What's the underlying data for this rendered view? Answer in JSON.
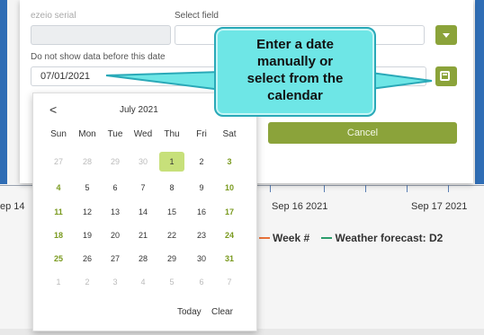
{
  "dialog": {
    "serial_label": "ezeio serial",
    "select_field_label": "Select field",
    "date_filter_label": "Do not show data before this date",
    "date_value": "07/01/2021",
    "cancel_label": "Cancel"
  },
  "calendar": {
    "month_title": "July 2021",
    "prev_glyph": "<",
    "weekdays": [
      "Sun",
      "Mon",
      "Tue",
      "Wed",
      "Thu",
      "Fri",
      "Sat"
    ],
    "weeks": [
      [
        "27",
        "28",
        "29",
        "30",
        "1",
        "2",
        "3"
      ],
      [
        "4",
        "5",
        "6",
        "7",
        "8",
        "9",
        "10"
      ],
      [
        "11",
        "12",
        "13",
        "14",
        "15",
        "16",
        "17"
      ],
      [
        "18",
        "19",
        "20",
        "21",
        "22",
        "23",
        "24"
      ],
      [
        "25",
        "26",
        "27",
        "28",
        "29",
        "30",
        "31"
      ],
      [
        "1",
        "2",
        "3",
        "4",
        "5",
        "6",
        "7"
      ]
    ],
    "selected_day": "1",
    "today_label": "Today",
    "clear_label": "Clear"
  },
  "callout": {
    "lines": [
      "Enter a date",
      "manually or",
      "select from the",
      "calendar"
    ]
  },
  "background": {
    "axis_labels": [
      "ep 14",
      "Sep 16 2021",
      "Sep 17 2021"
    ],
    "legend": [
      {
        "label": "Week #",
        "color": "#e8733a"
      },
      {
        "label": "Weather forecast: D2",
        "color": "#2a9d6b"
      }
    ]
  },
  "colors": {
    "accent_green": "#8ba33a",
    "selected_day_bg": "#c7e07a",
    "callout_fill": "#6ee6e6"
  }
}
